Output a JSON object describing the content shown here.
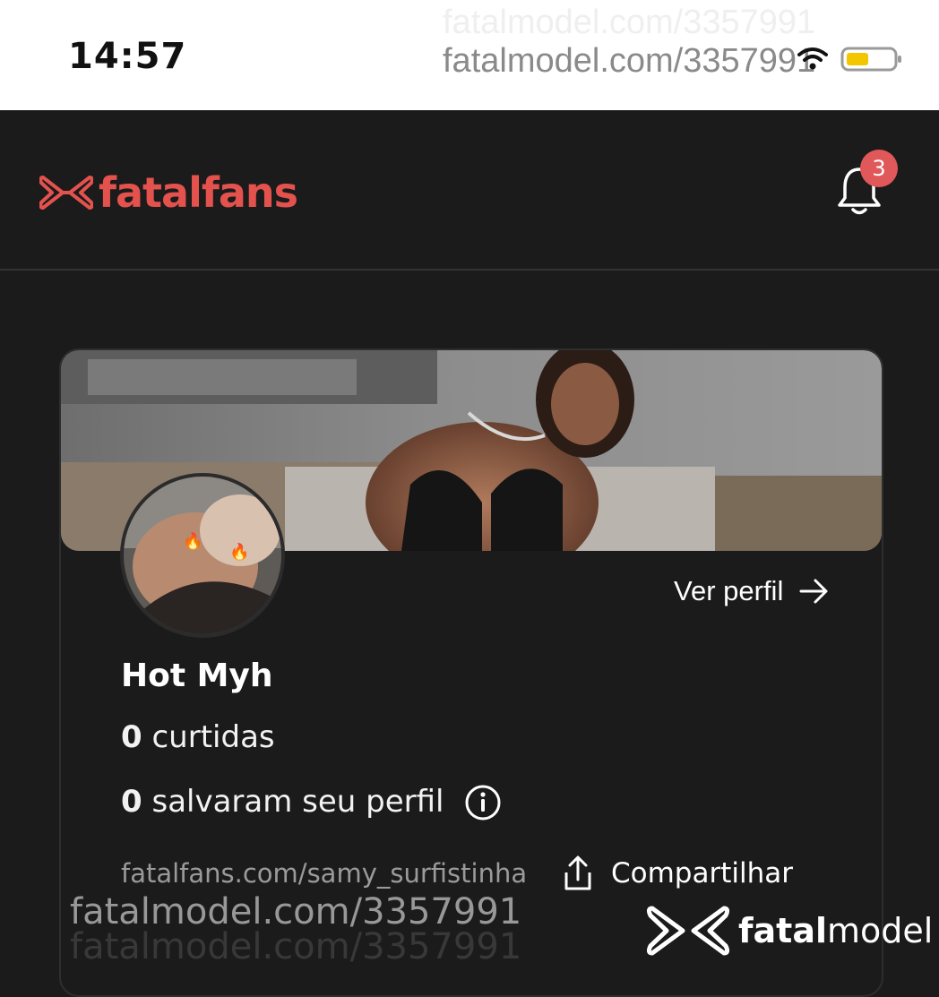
{
  "status_bar": {
    "time": "14:57",
    "url_watermark": "fatalmodel.com/3357991",
    "url_ghost": "fatalmodel.com/3357991"
  },
  "header": {
    "logo_text": "fatalfans",
    "brand_color": "#e4524e",
    "notification_count": "3"
  },
  "profile": {
    "name": "Hot Myh",
    "likes_count": "0",
    "likes_label": "curtidas",
    "saves_count": "0",
    "saves_label": "salvaram seu perfil",
    "view_profile_label": "Ver perfil",
    "profile_url": "fatalfans.com/samy_surfistinha",
    "share_label": "Compartilhar"
  },
  "watermark": {
    "url_primary": "fatalmodel.com/3357991",
    "url_secondary": "fatalmodel.com/3357991",
    "brand_bold": "fatal",
    "brand_rest": "model"
  }
}
